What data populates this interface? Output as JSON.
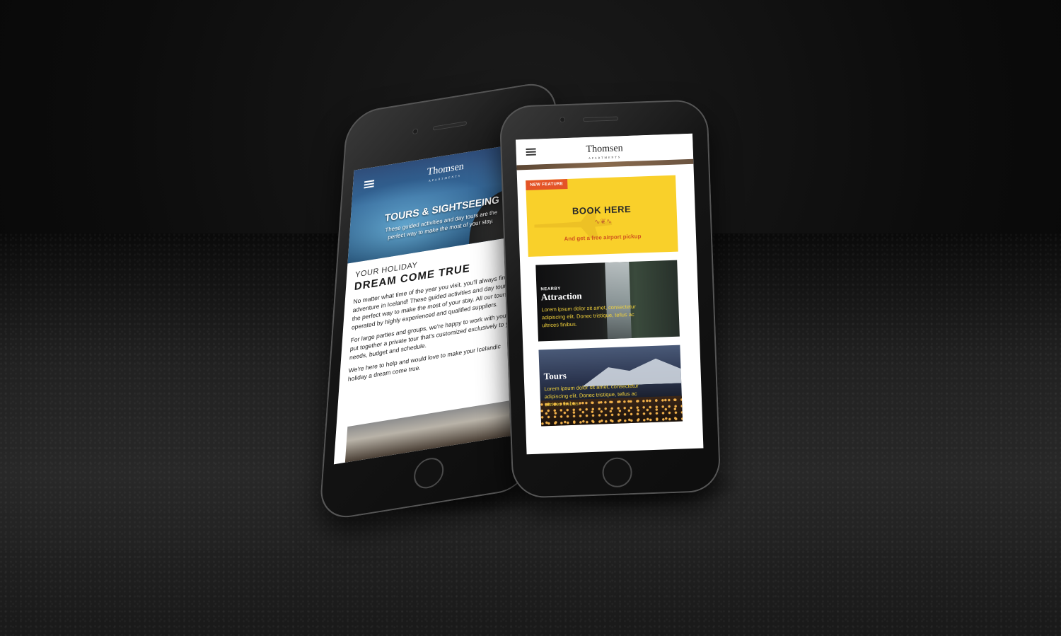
{
  "left_phone": {
    "brand": "Thomsen",
    "brand_sub": "APARTMENTS",
    "hero_title": "TOURS & SIGHTSEEING",
    "hero_description": "These guided activities and day tours are the perfect way to make the most of your stay.",
    "eyebrow": "YOUR HOLIDAY",
    "headline": "DREAM COME TRUE",
    "paragraphs": [
      "No matter what time of the year you visit, you'll always find an adventure in Iceland! These guided activities and day tours are the perfect way to make the most of your stay. All our tours are operated by highly experienced and qualified suppliers.",
      "For large parties and groups, we're happy to work with you and put together a private tour that's customized exclusively to your needs, budget and schedule.",
      "We're here to help and would love to make your Icelandic holiday a dream come true."
    ]
  },
  "right_phone": {
    "brand": "Thomsen",
    "brand_sub": "APARTMENTS",
    "promo": {
      "badge": "NEW FEATURE",
      "title": "BOOK HERE",
      "subtitle": "And get a free airport pickup"
    },
    "cards": [
      {
        "eyebrow": "NEARBY",
        "title": "Attraction",
        "text": "Lorem ipsum dolor sit amet, consectetur adipiscing elit. Donec tristique, tellus ac ultrices finibus."
      },
      {
        "eyebrow": "",
        "title": "Tours",
        "text": "Lorem ipsum dolor sit amet, consectetur adipiscing elit. Donec tristique, tellus ac ultrices finibus."
      }
    ]
  },
  "colors": {
    "promo_yellow": "#f9d02a",
    "badge_orange": "#e45427",
    "card_text_yellow": "#f2d23b",
    "promo_sub_orange": "#d0551f"
  },
  "icons": [
    "menu-icon",
    "swirl-ornament-icon",
    "plane-icon"
  ]
}
